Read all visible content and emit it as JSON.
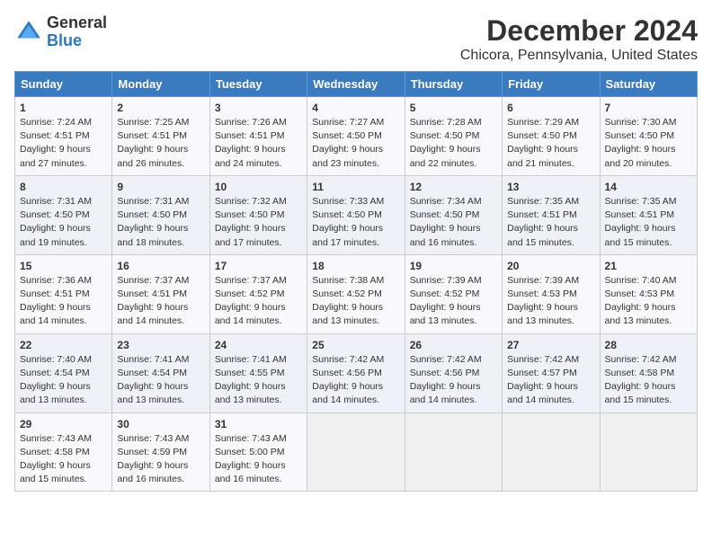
{
  "header": {
    "logo_general": "General",
    "logo_blue": "Blue",
    "title": "December 2024",
    "subtitle": "Chicora, Pennsylvania, United States"
  },
  "calendar": {
    "columns": [
      "Sunday",
      "Monday",
      "Tuesday",
      "Wednesday",
      "Thursday",
      "Friday",
      "Saturday"
    ],
    "rows": [
      [
        {
          "day": "1",
          "sunrise": "Sunrise: 7:24 AM",
          "sunset": "Sunset: 4:51 PM",
          "daylight": "Daylight: 9 hours and 27 minutes."
        },
        {
          "day": "2",
          "sunrise": "Sunrise: 7:25 AM",
          "sunset": "Sunset: 4:51 PM",
          "daylight": "Daylight: 9 hours and 26 minutes."
        },
        {
          "day": "3",
          "sunrise": "Sunrise: 7:26 AM",
          "sunset": "Sunset: 4:51 PM",
          "daylight": "Daylight: 9 hours and 24 minutes."
        },
        {
          "day": "4",
          "sunrise": "Sunrise: 7:27 AM",
          "sunset": "Sunset: 4:50 PM",
          "daylight": "Daylight: 9 hours and 23 minutes."
        },
        {
          "day": "5",
          "sunrise": "Sunrise: 7:28 AM",
          "sunset": "Sunset: 4:50 PM",
          "daylight": "Daylight: 9 hours and 22 minutes."
        },
        {
          "day": "6",
          "sunrise": "Sunrise: 7:29 AM",
          "sunset": "Sunset: 4:50 PM",
          "daylight": "Daylight: 9 hours and 21 minutes."
        },
        {
          "day": "7",
          "sunrise": "Sunrise: 7:30 AM",
          "sunset": "Sunset: 4:50 PM",
          "daylight": "Daylight: 9 hours and 20 minutes."
        }
      ],
      [
        {
          "day": "8",
          "sunrise": "Sunrise: 7:31 AM",
          "sunset": "Sunset: 4:50 PM",
          "daylight": "Daylight: 9 hours and 19 minutes."
        },
        {
          "day": "9",
          "sunrise": "Sunrise: 7:31 AM",
          "sunset": "Sunset: 4:50 PM",
          "daylight": "Daylight: 9 hours and 18 minutes."
        },
        {
          "day": "10",
          "sunrise": "Sunrise: 7:32 AM",
          "sunset": "Sunset: 4:50 PM",
          "daylight": "Daylight: 9 hours and 17 minutes."
        },
        {
          "day": "11",
          "sunrise": "Sunrise: 7:33 AM",
          "sunset": "Sunset: 4:50 PM",
          "daylight": "Daylight: 9 hours and 17 minutes."
        },
        {
          "day": "12",
          "sunrise": "Sunrise: 7:34 AM",
          "sunset": "Sunset: 4:50 PM",
          "daylight": "Daylight: 9 hours and 16 minutes."
        },
        {
          "day": "13",
          "sunrise": "Sunrise: 7:35 AM",
          "sunset": "Sunset: 4:51 PM",
          "daylight": "Daylight: 9 hours and 15 minutes."
        },
        {
          "day": "14",
          "sunrise": "Sunrise: 7:35 AM",
          "sunset": "Sunset: 4:51 PM",
          "daylight": "Daylight: 9 hours and 15 minutes."
        }
      ],
      [
        {
          "day": "15",
          "sunrise": "Sunrise: 7:36 AM",
          "sunset": "Sunset: 4:51 PM",
          "daylight": "Daylight: 9 hours and 14 minutes."
        },
        {
          "day": "16",
          "sunrise": "Sunrise: 7:37 AM",
          "sunset": "Sunset: 4:51 PM",
          "daylight": "Daylight: 9 hours and 14 minutes."
        },
        {
          "day": "17",
          "sunrise": "Sunrise: 7:37 AM",
          "sunset": "Sunset: 4:52 PM",
          "daylight": "Daylight: 9 hours and 14 minutes."
        },
        {
          "day": "18",
          "sunrise": "Sunrise: 7:38 AM",
          "sunset": "Sunset: 4:52 PM",
          "daylight": "Daylight: 9 hours and 13 minutes."
        },
        {
          "day": "19",
          "sunrise": "Sunrise: 7:39 AM",
          "sunset": "Sunset: 4:52 PM",
          "daylight": "Daylight: 9 hours and 13 minutes."
        },
        {
          "day": "20",
          "sunrise": "Sunrise: 7:39 AM",
          "sunset": "Sunset: 4:53 PM",
          "daylight": "Daylight: 9 hours and 13 minutes."
        },
        {
          "day": "21",
          "sunrise": "Sunrise: 7:40 AM",
          "sunset": "Sunset: 4:53 PM",
          "daylight": "Daylight: 9 hours and 13 minutes."
        }
      ],
      [
        {
          "day": "22",
          "sunrise": "Sunrise: 7:40 AM",
          "sunset": "Sunset: 4:54 PM",
          "daylight": "Daylight: 9 hours and 13 minutes."
        },
        {
          "day": "23",
          "sunrise": "Sunrise: 7:41 AM",
          "sunset": "Sunset: 4:54 PM",
          "daylight": "Daylight: 9 hours and 13 minutes."
        },
        {
          "day": "24",
          "sunrise": "Sunrise: 7:41 AM",
          "sunset": "Sunset: 4:55 PM",
          "daylight": "Daylight: 9 hours and 13 minutes."
        },
        {
          "day": "25",
          "sunrise": "Sunrise: 7:42 AM",
          "sunset": "Sunset: 4:56 PM",
          "daylight": "Daylight: 9 hours and 14 minutes."
        },
        {
          "day": "26",
          "sunrise": "Sunrise: 7:42 AM",
          "sunset": "Sunset: 4:56 PM",
          "daylight": "Daylight: 9 hours and 14 minutes."
        },
        {
          "day": "27",
          "sunrise": "Sunrise: 7:42 AM",
          "sunset": "Sunset: 4:57 PM",
          "daylight": "Daylight: 9 hours and 14 minutes."
        },
        {
          "day": "28",
          "sunrise": "Sunrise: 7:42 AM",
          "sunset": "Sunset: 4:58 PM",
          "daylight": "Daylight: 9 hours and 15 minutes."
        }
      ],
      [
        {
          "day": "29",
          "sunrise": "Sunrise: 7:43 AM",
          "sunset": "Sunset: 4:58 PM",
          "daylight": "Daylight: 9 hours and 15 minutes."
        },
        {
          "day": "30",
          "sunrise": "Sunrise: 7:43 AM",
          "sunset": "Sunset: 4:59 PM",
          "daylight": "Daylight: 9 hours and 16 minutes."
        },
        {
          "day": "31",
          "sunrise": "Sunrise: 7:43 AM",
          "sunset": "Sunset: 5:00 PM",
          "daylight": "Daylight: 9 hours and 16 minutes."
        },
        null,
        null,
        null,
        null
      ]
    ]
  }
}
